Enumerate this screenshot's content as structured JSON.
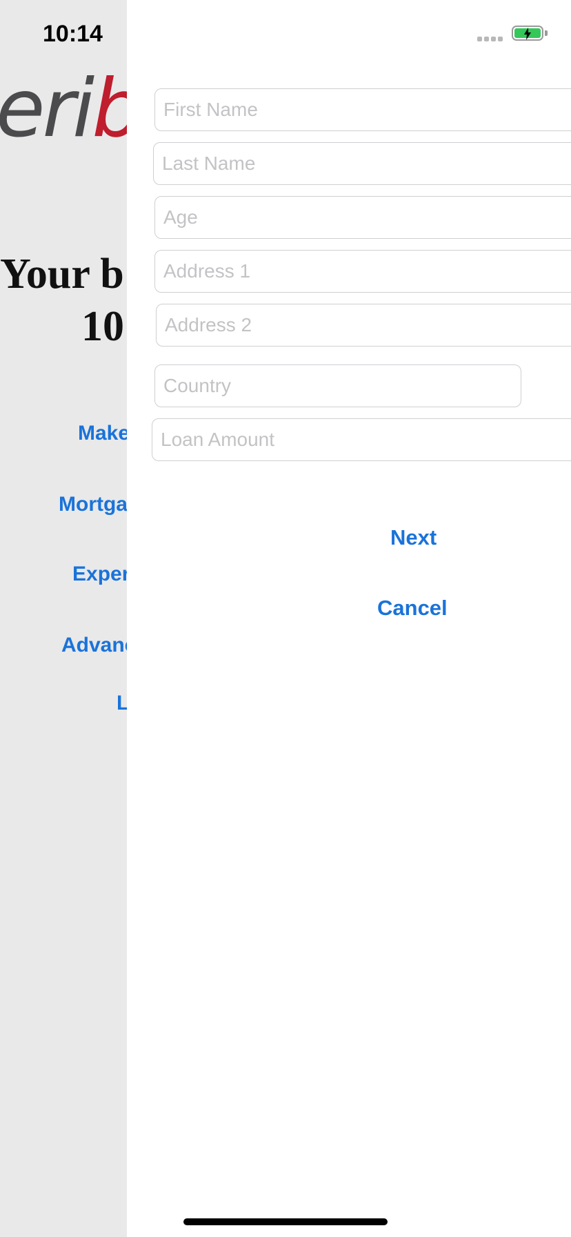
{
  "status_bar": {
    "time": "10:14",
    "battery_icon": "battery-charging-icon",
    "signal_icon": "cellular-signal-icon"
  },
  "background_screen": {
    "logo_text_dark": "eri",
    "logo_text_red": "b",
    "heading_line1": "Your b",
    "heading_line2": "10",
    "links": [
      "Make",
      "Mortga",
      "Exper",
      "Advanc",
      "L"
    ],
    "colors": {
      "background": "#e9e9ea",
      "logo_dark": "#4b4b4d",
      "logo_red": "#be1e2d",
      "link": "#1a73d9"
    }
  },
  "form": {
    "first_name_placeholder": "First Name",
    "last_name_placeholder": "Last Name",
    "age_placeholder": "Age",
    "address1_placeholder": "Address 1",
    "address2_placeholder": "Address 2",
    "country_placeholder": "Country",
    "loan_amount_placeholder": "Loan Amount"
  },
  "actions": {
    "next_label": "Next",
    "cancel_label": "Cancel"
  },
  "colors": {
    "accent": "#1a73d9",
    "field_border": "#cfcfd1",
    "placeholder": "#c3c3c6",
    "battery_fill": "#34c759"
  }
}
